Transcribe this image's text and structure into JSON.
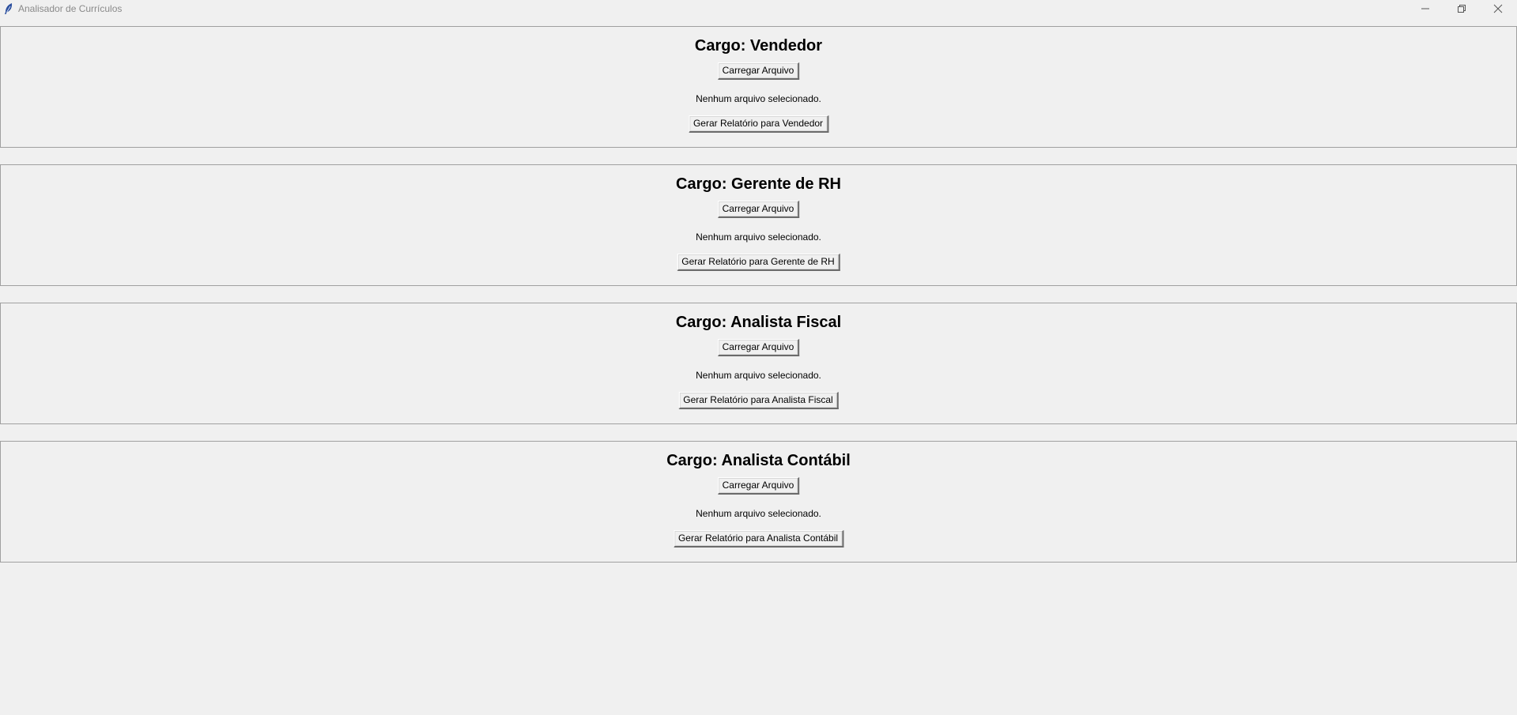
{
  "window": {
    "title": "Analisador de Currículos",
    "icon": "feather-icon"
  },
  "sections": [
    {
      "title": "Cargo: Vendedor",
      "load_button": "Carregar Arquivo",
      "status": "Nenhum arquivo selecionado.",
      "report_button": "Gerar Relatório para Vendedor"
    },
    {
      "title": "Cargo: Gerente de RH",
      "load_button": "Carregar Arquivo",
      "status": "Nenhum arquivo selecionado.",
      "report_button": "Gerar Relatório para Gerente de RH"
    },
    {
      "title": "Cargo: Analista Fiscal",
      "load_button": "Carregar Arquivo",
      "status": "Nenhum arquivo selecionado.",
      "report_button": "Gerar Relatório para Analista Fiscal"
    },
    {
      "title": "Cargo: Analista Contábil",
      "load_button": "Carregar Arquivo",
      "status": "Nenhum arquivo selecionado.",
      "report_button": "Gerar Relatório para Analista Contábil"
    }
  ]
}
